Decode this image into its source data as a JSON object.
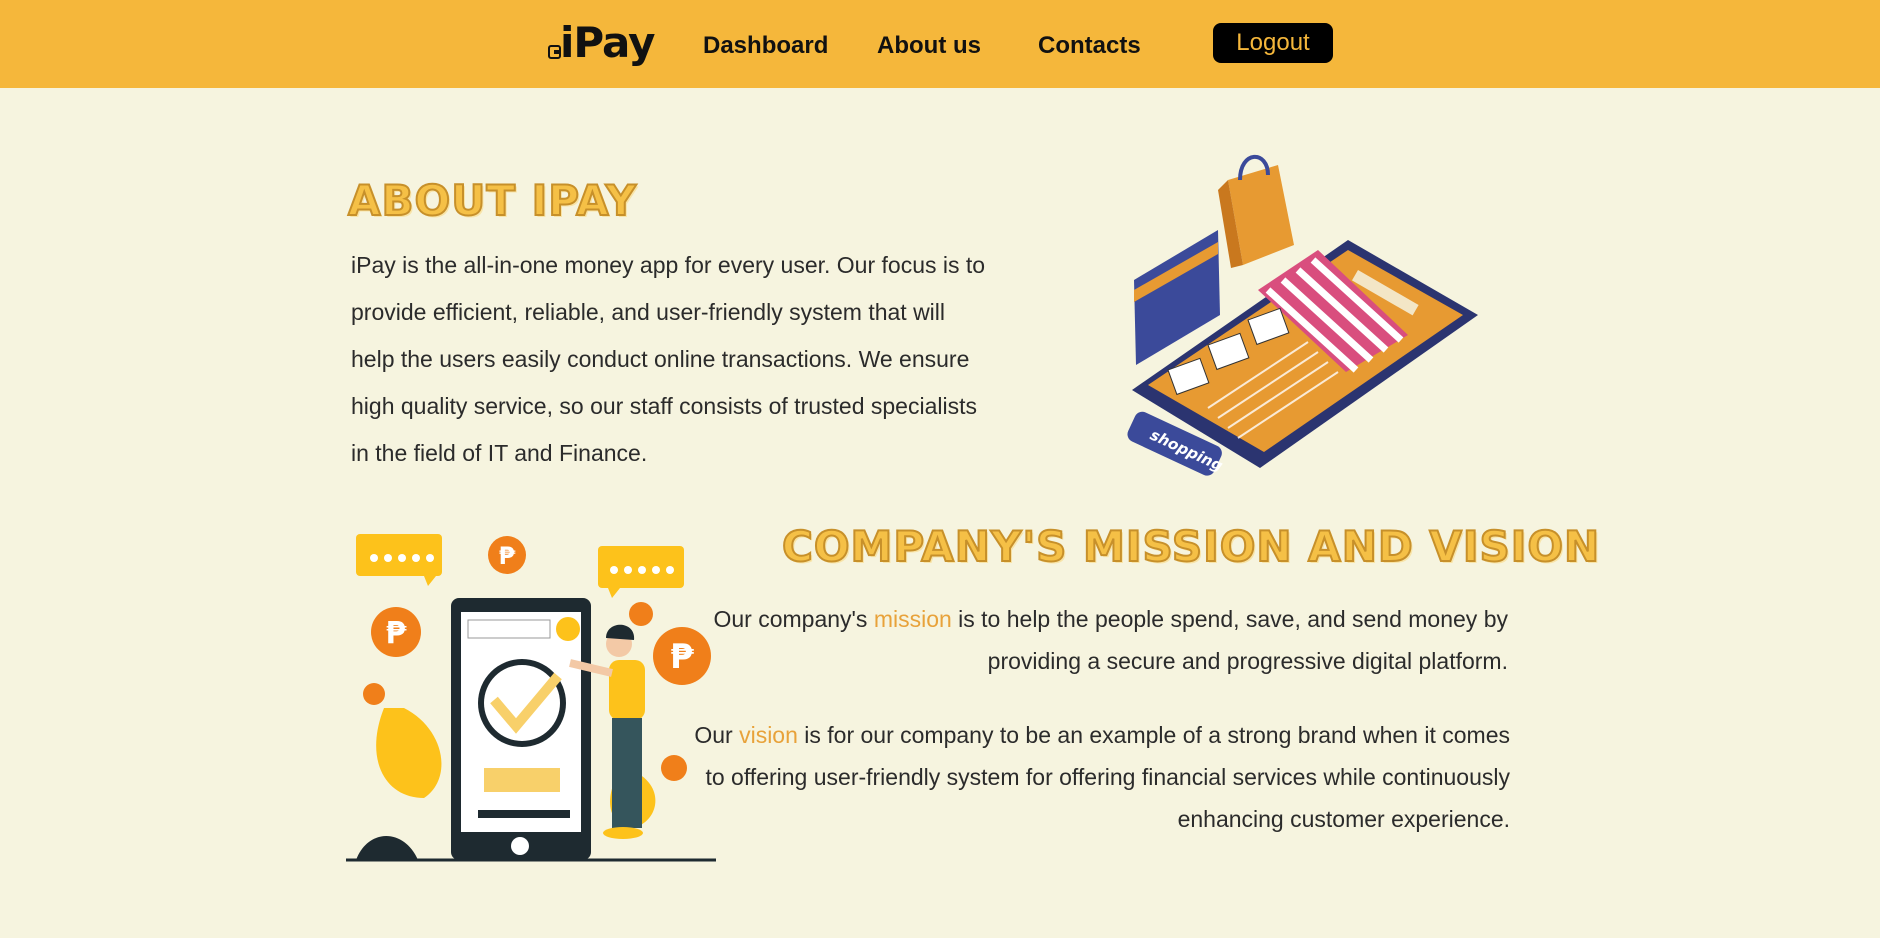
{
  "navbar": {
    "logo_text": "iPay",
    "links": [
      {
        "label": "Dashboard"
      },
      {
        "label": "About us"
      },
      {
        "label": "Contacts"
      }
    ],
    "logout_label": "Logout",
    "bg_color": "#f5b73b"
  },
  "about": {
    "heading": "About iPay",
    "body": "iPay is the all-in-one money app for every user. Our focus is to provide efficient, reliable, and user-friendly system that will help the users easily conduct online transactions. We ensure high quality service,  so our staff consists of trusted specialists in the field of IT and Finance.",
    "illustration_badge": "shopping"
  },
  "mission_vision": {
    "heading": "Company's Mission and Vision",
    "mission": {
      "pre": "Our company's ",
      "highlight": "mission",
      "post": " is to help the people spend, save, and send money by providing a secure and progressive digital platform."
    },
    "vision": {
      "pre": "Our ",
      "highlight": "vision",
      "post": " is for our company to be an example of a strong brand when it comes to offering user-friendly system for offering financial services while continuously enhancing customer experience."
    },
    "illustration_currency": "₱"
  },
  "colors": {
    "page_bg": "#f6f4df",
    "accent": "#f5b73b",
    "highlight": "#e8a23a",
    "text": "#2b2b2b"
  }
}
